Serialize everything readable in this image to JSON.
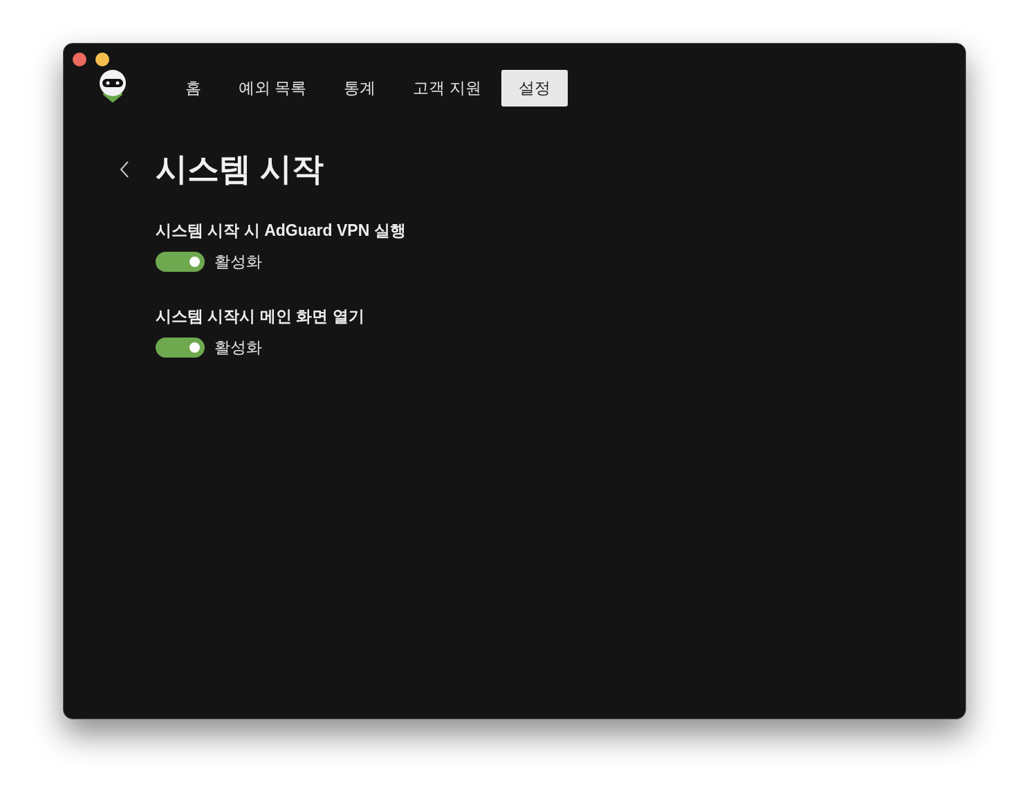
{
  "window": {
    "traffic_lights": [
      {
        "kind": "close"
      },
      {
        "kind": "minimize"
      }
    ]
  },
  "tabs": [
    {
      "label": "홈",
      "selected": false
    },
    {
      "label": "예외 목록",
      "selected": false
    },
    {
      "label": "통계",
      "selected": false
    },
    {
      "label": "고객 지원",
      "selected": false
    },
    {
      "label": "설정",
      "selected": true
    }
  ],
  "page": {
    "title": "시스템 시작"
  },
  "settings": [
    {
      "title": "시스템 시작 시 AdGuard VPN 실행",
      "toggle_label": "활성화",
      "on": true
    },
    {
      "title": "시스템 시작시 메인 화면 열기",
      "toggle_label": "활성화",
      "on": true
    }
  ]
}
